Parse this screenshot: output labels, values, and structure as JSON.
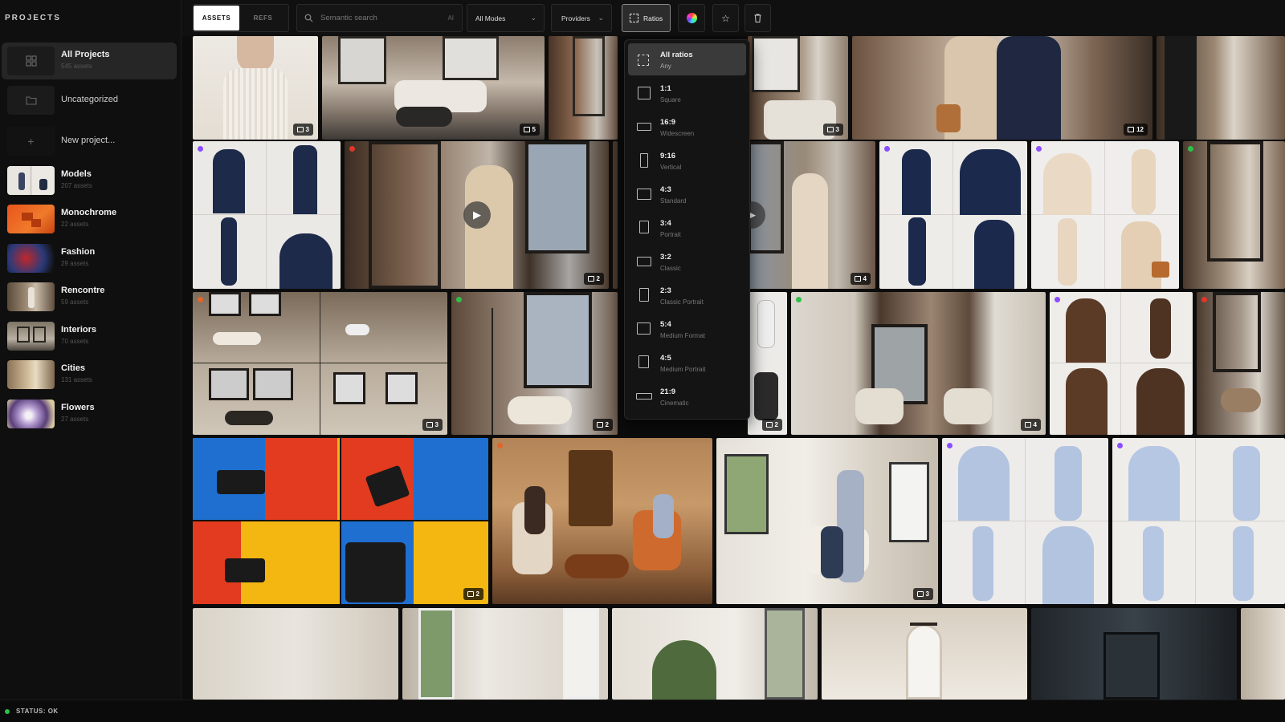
{
  "sidebar": {
    "heading": "PROJECTS",
    "projects": [
      {
        "name": "All Projects",
        "count": "545 assets"
      },
      {
        "name": "Uncategorized",
        "count": ""
      },
      {
        "name": "New project...",
        "count": ""
      },
      {
        "name": "Models",
        "count": "207 assets"
      },
      {
        "name": "Monochrome",
        "count": "22 assets"
      },
      {
        "name": "Fashion",
        "count": "29 assets"
      },
      {
        "name": "Rencontre",
        "count": "59 assets"
      },
      {
        "name": "Interiors",
        "count": "70 assets"
      },
      {
        "name": "Cities",
        "count": "131 assets"
      },
      {
        "name": "Flowers",
        "count": "27 assets"
      }
    ]
  },
  "toolbar": {
    "tab_assets": "ASSETS",
    "tab_refs": "REFS",
    "search_placeholder": "Semantic search",
    "search_ai_label": "AI",
    "modes_label": "All Modes",
    "providers_label": "Providers",
    "ratios_label": "Ratios"
  },
  "ratios_menu": {
    "options": [
      {
        "name": "All ratios",
        "desc": "Any",
        "selected": true
      },
      {
        "name": "1:1",
        "desc": "Square"
      },
      {
        "name": "16:9",
        "desc": "Widescreen"
      },
      {
        "name": "9:16",
        "desc": "Vertical"
      },
      {
        "name": "4:3",
        "desc": "Standard"
      },
      {
        "name": "3:4",
        "desc": "Portrait"
      },
      {
        "name": "3:2",
        "desc": "Classic"
      },
      {
        "name": "2:3",
        "desc": "Classic Portrait"
      },
      {
        "name": "5:4",
        "desc": "Medium Format"
      },
      {
        "name": "4:5",
        "desc": "Medium Portrait"
      },
      {
        "name": "21:9",
        "desc": "Cinematic"
      }
    ]
  },
  "grid": {
    "badges": [
      "3",
      "5",
      "3",
      "12",
      "2",
      "4",
      "3",
      "2",
      "2",
      "4",
      "2",
      "3"
    ]
  },
  "colors": {
    "purple_dot": "#8a4dff",
    "red_dot": "#e0362b",
    "green_dot": "#2ec04a",
    "orange_dot": "#e2662a"
  },
  "status": {
    "text": "STATUS: OK"
  }
}
